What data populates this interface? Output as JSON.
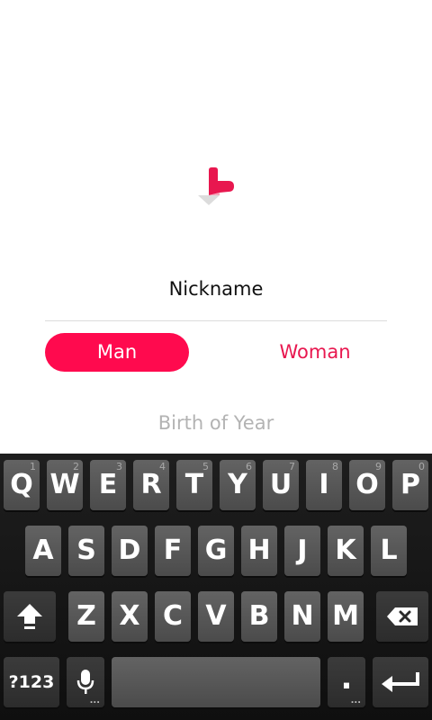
{
  "form": {
    "nickname_placeholder": "Nickname",
    "gender_options": [
      "Man",
      "Woman"
    ],
    "selected_gender": "Man",
    "birth_placeholder": "Birth of Year"
  },
  "keyboard": {
    "row1": [
      {
        "label": "Q",
        "hint": "1"
      },
      {
        "label": "W",
        "hint": "2"
      },
      {
        "label": "E",
        "hint": "3"
      },
      {
        "label": "R",
        "hint": "4"
      },
      {
        "label": "T",
        "hint": "5"
      },
      {
        "label": "Y",
        "hint": "6"
      },
      {
        "label": "U",
        "hint": "7"
      },
      {
        "label": "I",
        "hint": "8"
      },
      {
        "label": "O",
        "hint": "9"
      },
      {
        "label": "P",
        "hint": "0"
      }
    ],
    "row2": [
      "A",
      "S",
      "D",
      "F",
      "G",
      "H",
      "J",
      "K",
      "L"
    ],
    "row3": [
      "Z",
      "X",
      "C",
      "V",
      "B",
      "N",
      "M"
    ],
    "symbols_label": "?123",
    "period_label": ".",
    "more_dots": "...",
    "icons": {
      "shift": "shift-icon",
      "backspace": "backspace-icon",
      "mic": "microphone-icon",
      "enter": "enter-icon"
    }
  },
  "colors": {
    "accent": "#ff0a4e",
    "accent_text": "#e8174f",
    "placeholder": "#b3b3b3",
    "keyboard_bg": "#151515",
    "key_bg": "#555555"
  }
}
